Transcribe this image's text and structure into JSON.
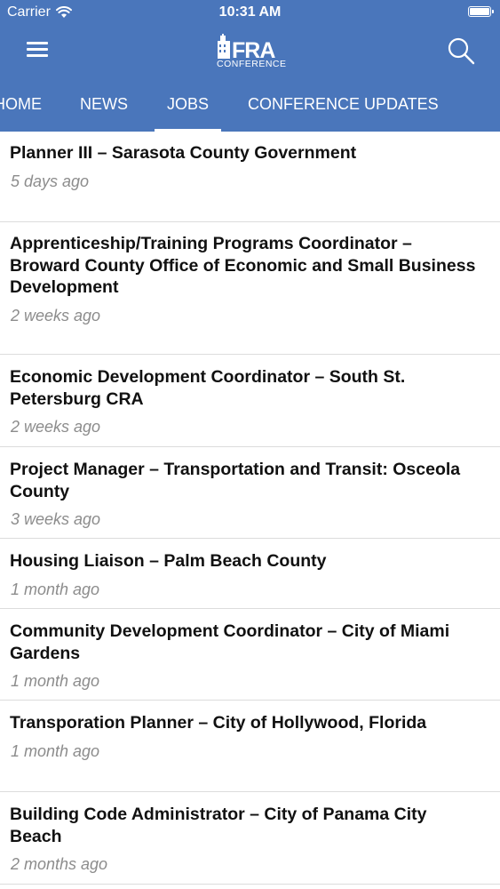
{
  "status": {
    "carrier": "Carrier",
    "time": "10:31 AM"
  },
  "header": {
    "logo_text": "FRA",
    "logo_sub": "CONFERENCE",
    "menu_icon": "hamburger-menu-icon",
    "search_icon": "search-icon",
    "background_color": "#4a76bb"
  },
  "tabs": [
    {
      "label": "HOME"
    },
    {
      "label": "NEWS"
    },
    {
      "label": "JOBS",
      "active": true
    },
    {
      "label": "CONFERENCE UPDATES"
    }
  ],
  "jobs": [
    {
      "title": "Planner III – Sarasota County Government",
      "date": "5 days ago"
    },
    {
      "title": "Apprenticeship/Training Programs Coordinator – Broward County Office of Economic and Small Business Development",
      "date": "2 weeks ago"
    },
    {
      "title": "Economic Development Coordinator – South St. Petersburg CRA",
      "date": "2 weeks ago"
    },
    {
      "title": "Project Manager – Transportation and Transit: Osceola County",
      "date": "3 weeks ago"
    },
    {
      "title": "Housing Liaison – Palm Beach County",
      "date": "1 month ago"
    },
    {
      "title": "Community Development Coordinator – City of Miami Gardens",
      "date": "1 month ago"
    },
    {
      "title": "Transporation Planner – City of Hollywood, Florida",
      "date": "1 month ago"
    },
    {
      "title": "Building Code Administrator – City of Panama City Beach",
      "date": "2 months ago"
    }
  ]
}
